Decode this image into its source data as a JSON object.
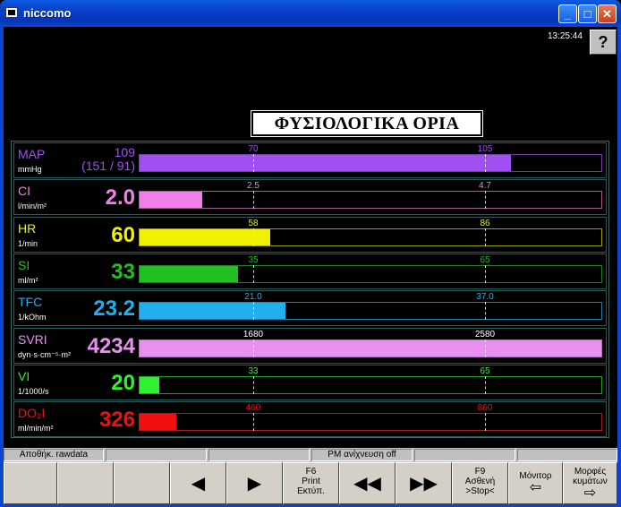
{
  "window": {
    "title": "niccomo",
    "min": "_",
    "max": "□",
    "close": "✕"
  },
  "clock": "13:25:44",
  "help_label": "?",
  "heading": "ΦΥΣΙΟΛΟΓΙΚΑ ΟΡΙΑ",
  "colors": {
    "purple": "#a040f0",
    "pink": "#f080f0",
    "yellow": "#f0f000",
    "green": "#20c020",
    "blue": "#20b0f0",
    "lilac": "#e090f0",
    "lime": "#30f030",
    "red": "#f01010"
  },
  "params": [
    {
      "name": "MAP",
      "unit": "mmHg",
      "value": "109",
      "sub": "(151 / 91)",
      "color": "#a050f0",
      "border": "#7040a0",
      "low": "70",
      "high": "105",
      "fill_fraction": 0.805
    },
    {
      "name": "CI",
      "unit": "l/min/m²",
      "value": "2.0",
      "color": "#f080e8",
      "border": "#a06090",
      "low": "2.5",
      "high": "4.7",
      "fill_fraction": 0.135
    },
    {
      "name": "HR",
      "unit": "1/min",
      "value": "60",
      "color": "#f0f000",
      "border": "#a0a000",
      "low": "58",
      "high": "86",
      "fill_fraction": 0.283
    },
    {
      "name": "SI",
      "unit": "ml/m²",
      "value": "33",
      "color": "#20c020",
      "border": "#208020",
      "low": "35",
      "high": "65",
      "fill_fraction": 0.213
    },
    {
      "name": "TFC",
      "unit": "1/kOhm",
      "value": "23.2",
      "color": "#20b0f0",
      "border": "#2080b0",
      "low": "21.0",
      "high": "37.0",
      "fill_fraction": 0.315
    },
    {
      "name": "SVRI",
      "unit": "dyn·s·cm⁻⁵·m²",
      "value": "4234",
      "color": "#e890f0",
      "border": "#b070c0",
      "low": "1680",
      "high": "2580",
      "fill_fraction": 1.0
    },
    {
      "name": "VI",
      "unit": "1/1000/s",
      "value": "20",
      "color": "#30f030",
      "border": "#20a020",
      "low": "33",
      "high": "65",
      "fill_fraction": 0.043
    },
    {
      "name": "DO₂I",
      "unit": "ml/min/m²",
      "value": "326",
      "color": "#f01010",
      "border": "#a02020",
      "low": "460",
      "high": "860",
      "fill_fraction": 0.08
    }
  ],
  "status": {
    "rawdata": "Αποθήκ. rawdata",
    "pm": "PM ανίχνευση off"
  },
  "fkeys": {
    "prev": "◀",
    "next": "▶",
    "f6": "F6",
    "f6_l1": "Print",
    "f6_l2": "Εκτύπ.",
    "rew": "◀◀",
    "ffw": "▶▶",
    "f9": "F9",
    "f9_l1": "Ασθενή",
    "f9_l2": ">Stop<",
    "monitor": "Μόνιτορ",
    "monitor_icon": "⇦",
    "waves_l1": "Μορφές",
    "waves_l2": "κυμάτων",
    "waves_icon": "⇨"
  }
}
